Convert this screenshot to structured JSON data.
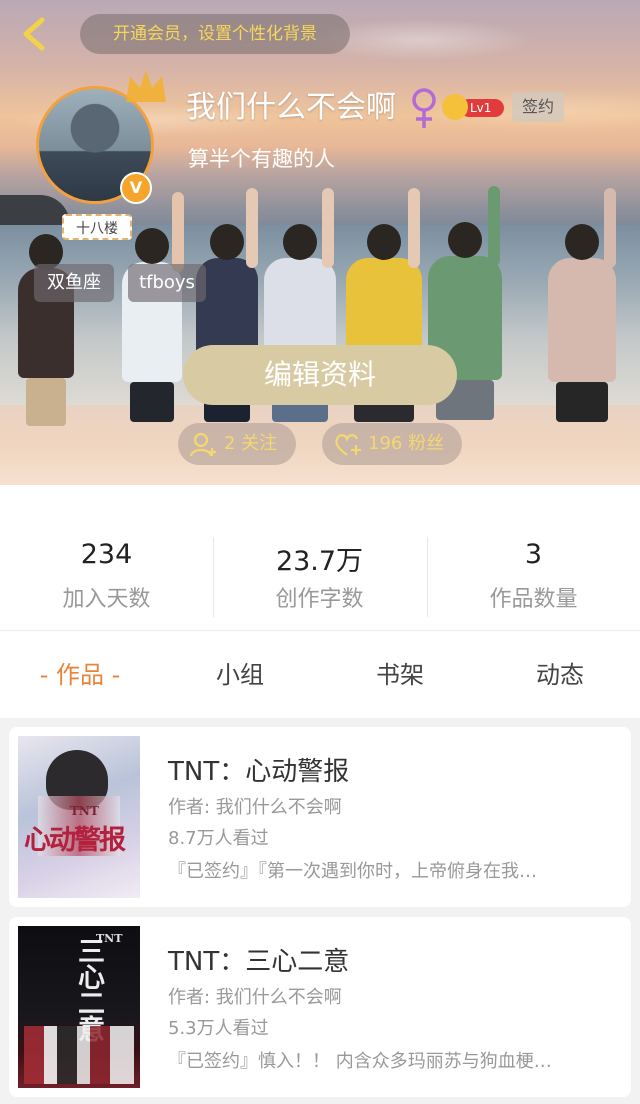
{
  "header": {
    "vip_promo": "开通会员，设置个性化背景",
    "floor_tag": "十八楼",
    "verified_mark": "V",
    "nickname": "我们什么不会啊",
    "level": "Lv1",
    "signed_badge": "签约",
    "bio": "算半个有趣的人",
    "tags": [
      "双鱼座",
      "tfboys"
    ],
    "edit_button": "编辑资料",
    "following": "2 关注",
    "followers": "196 粉丝"
  },
  "stats": [
    {
      "value": "234",
      "label": "加入天数"
    },
    {
      "value": "23.7万",
      "label": "创作字数"
    },
    {
      "value": "3",
      "label": "作品数量"
    }
  ],
  "tabs": [
    {
      "label": "- 作品 -",
      "active": true
    },
    {
      "label": "小组",
      "active": false
    },
    {
      "label": "书架",
      "active": false
    },
    {
      "label": "动态",
      "active": false
    }
  ],
  "books": [
    {
      "title": "TNT：心动警报",
      "author": "作者: 我们什么不会啊",
      "views": "8.7万人看过",
      "description": "『已签约』『第一次遇到你时，上帝俯身在我…",
      "cover_text": "心动警报",
      "cover_badge": "TNT"
    },
    {
      "title": "TNT：三心二意",
      "author": "作者: 我们什么不会啊",
      "views": "5.3万人看过",
      "description": "『已签约』慎入！！ 内含众多玛丽苏与狗血梗…",
      "cover_text": "三心二意",
      "cover_badge": "TNT"
    }
  ],
  "colors": {
    "accent_orange": "#e8843a",
    "vip_yellow": "#f7d75a",
    "edit_button": "#d8cba3",
    "level_red": "#e23b3b"
  }
}
